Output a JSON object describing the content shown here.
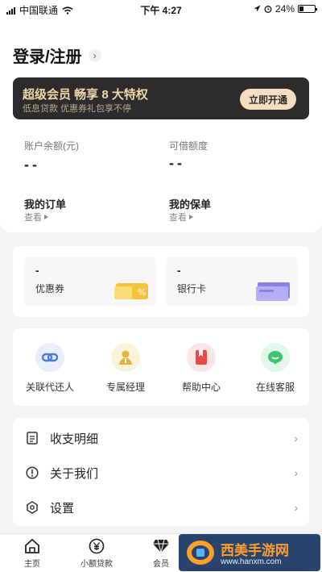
{
  "status": {
    "carrier": "中国联通",
    "time": "下午 4:27",
    "battery": "24%"
  },
  "header": {
    "login_text": "登录/注册",
    "chevron": "›"
  },
  "vip": {
    "title": "超级会员  畅享 8 大特权",
    "subtitle": "低息贷款 优惠券礼包享不停",
    "button": "立即开通"
  },
  "account": {
    "balance_label": "账户余额(元)",
    "balance_value": "--",
    "credit_label": "可借额度",
    "credit_value": "--",
    "orders_title": "我的订单",
    "orders_link": "查看",
    "policies_title": "我的保单",
    "policies_link": "查看"
  },
  "wallet": {
    "coupon": {
      "value": "-",
      "label": "优惠券"
    },
    "card": {
      "value": "-",
      "label": "银行卡"
    }
  },
  "services": [
    {
      "label": "关联代还人",
      "icon": "link-icon"
    },
    {
      "label": "专属经理",
      "icon": "manager-icon"
    },
    {
      "label": "帮助中心",
      "icon": "help-book-icon"
    },
    {
      "label": "在线客服",
      "icon": "chat-icon"
    }
  ],
  "menu": [
    {
      "label": "收支明细",
      "icon": "document-icon"
    },
    {
      "label": "关于我们",
      "icon": "info-icon"
    },
    {
      "label": "设置",
      "icon": "settings-icon"
    }
  ],
  "tabs": [
    {
      "label": "主页",
      "icon": "home-icon"
    },
    {
      "label": "小额贷款",
      "icon": "yen-icon"
    },
    {
      "label": "会员",
      "icon": "diamond-icon"
    }
  ],
  "watermark": {
    "title": "西美手游网",
    "url": "www.hanxm.com"
  },
  "colors": {
    "vip_gold": "#f0d7a8",
    "vip_bg": "#2c2c2e",
    "accent_blue": "#4a7bd8",
    "accent_red": "#e84a4a",
    "accent_green": "#3cc56f",
    "accent_gold": "#e8b13a"
  }
}
